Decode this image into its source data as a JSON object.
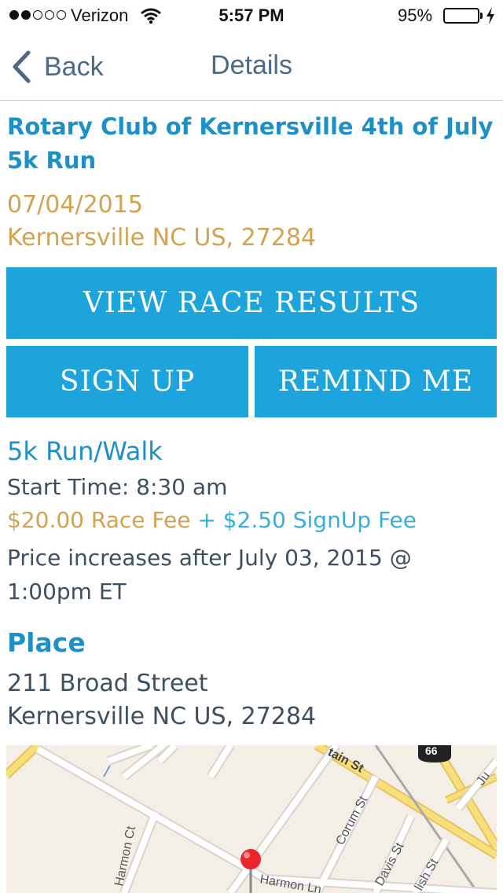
{
  "status_bar": {
    "carrier": "Verizon",
    "time": "5:57 PM",
    "battery_percent": "95%",
    "signal_bars_filled": 2,
    "signal_bars_total": 5,
    "battery_level": 0.95
  },
  "nav": {
    "back_label": "Back",
    "title": "Details"
  },
  "race": {
    "title": "Rotary Club of Kernersville 4th of July 5k Run",
    "date": "07/04/2015",
    "location": "Kernersville NC US, 27284"
  },
  "buttons": {
    "view_results": "VIEW RACE RESULTS",
    "sign_up": "SIGN UP",
    "remind_me": "REMIND ME"
  },
  "event": {
    "name": "5k Run/Walk",
    "start_time": "Start Time: 8:30 am",
    "race_fee": "$20.00 Race Fee",
    "signup_fee": " + $2.50 SignUp Fee",
    "price_note": "Price increases after July 03, 2015 @ 1:00pm ET"
  },
  "place": {
    "heading": "Place",
    "street": "211 Broad Street",
    "city": "Kernersville NC US, 27284"
  },
  "map": {
    "labels": {
      "harmon_ct": "Harmon Ct",
      "harmon_ln": "Harmon Ln",
      "corum_st": "Corum St",
      "davis_st": "Davis St",
      "mountain_st": "tain St",
      "english_st": "lish St",
      "ju": "Ju",
      "route_shield": "66"
    }
  },
  "colors": {
    "accent_blue": "#1e90c8",
    "button_blue": "#1ea4dc",
    "gold": "#d4a14e",
    "text_gray": "#3d4f60",
    "battery_green": "#4cd964"
  },
  "icons": {
    "back": "chevron-left-icon",
    "wifi": "wifi-icon",
    "battery": "battery-icon",
    "charging": "lightning-bolt-icon",
    "map_pin": "map-pin-icon"
  }
}
